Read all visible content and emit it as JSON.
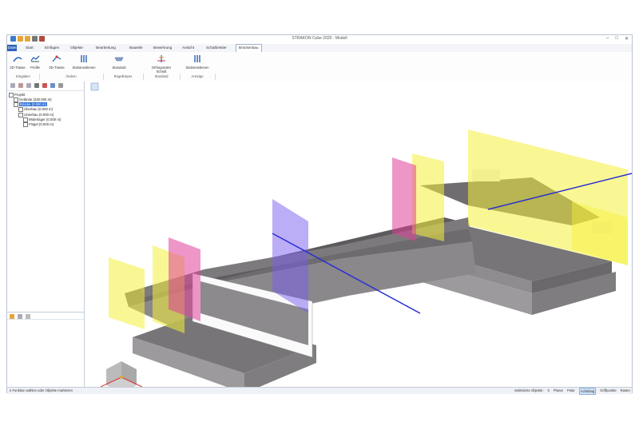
{
  "window": {
    "title": "STRAKON Cube 2020 - Modell"
  },
  "tabs": [
    "Start",
    "Einfügen",
    "Objekte",
    "Bearbeitung",
    "Bauteile",
    "Bewehrung",
    "Ansicht",
    "Schalbrettier",
    "Brückenbau"
  ],
  "file_tab": "Datei",
  "ribbon": {
    "buttons": [
      "2D-Trasse",
      "Profile",
      "3D-Trasse",
      "Stationsebenen",
      "Standard",
      "Orthogonaler Schnitt",
      "Stationsebenen"
    ],
    "groups": [
      "Eingaben",
      "Ändern",
      "Regelkörper",
      "Standard",
      "Anzeige"
    ]
  },
  "tree": {
    "items": [
      {
        "label": "Projekt",
        "level": 0
      },
      {
        "label": "Gelände (230.000 m)",
        "level": 1
      },
      {
        "label": "Brücke (0.000 m)",
        "level": 1,
        "selected": true
      },
      {
        "label": "Überbau (0.000 m)",
        "level": 2
      },
      {
        "label": "Unterbau (0.000 m)",
        "level": 2
      },
      {
        "label": "Widerlager (0.000 m)",
        "level": 3
      },
      {
        "label": "Flügel (0.000 m)",
        "level": 3
      }
    ]
  },
  "statusbar": {
    "hint": "e Funktion wählen oder Objekte markieren",
    "selected_label": "Selektierte Objekte:",
    "selected_count": "0",
    "toggles": [
      {
        "label": "Planar",
        "active": false
      },
      {
        "label": "Polar",
        "active": false
      },
      {
        "label": "Achsfang",
        "active": true
      },
      {
        "label": "Griffpunkte",
        "active": false
      },
      {
        "label": "Raster",
        "active": false
      }
    ]
  },
  "colors": {
    "accent": "#2b63b8",
    "plane_yellow": "#f4f03a",
    "plane_magenta": "#e0409a",
    "plane_violet": "#7a5cf0",
    "concrete": "#8c8a8c",
    "axis_line": "#2a2fd0"
  },
  "icons": [
    "save-icon",
    "undo-icon",
    "redo-icon",
    "print-icon",
    "close-icon",
    "nav-cube-icon"
  ]
}
